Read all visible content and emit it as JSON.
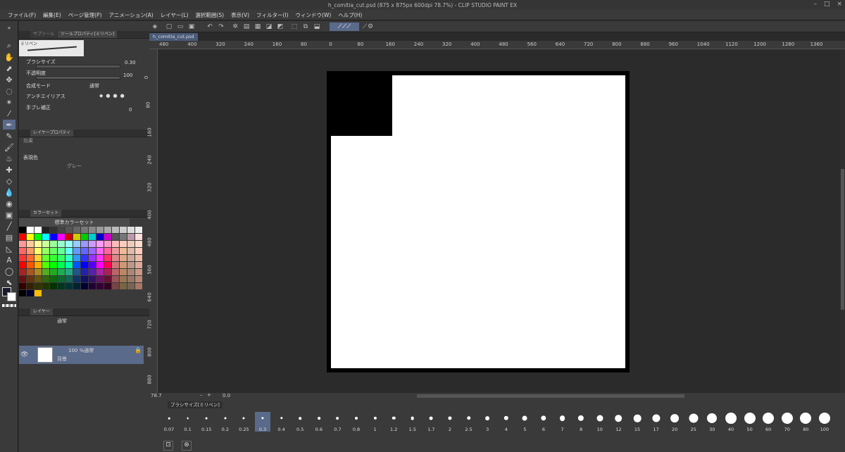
{
  "window": {
    "title": "h_comitia_cut.psd (875 x 875px 600dpi 78.7%) - CLIP STUDIO PAINT EX",
    "controls": [
      "–",
      "□",
      "×"
    ]
  },
  "menu": [
    "ファイル(F)",
    "編集(E)",
    "ページ管理(P)",
    "アニメーション(A)",
    "レイヤー(L)",
    "選択範囲(S)",
    "表示(V)",
    "フィルター(I)",
    "ウィンドウ(W)",
    "ヘルプ(H)"
  ],
  "tool_property": {
    "tabs": [
      "サブツール",
      "ツールプロパティ[ミリペン]"
    ],
    "brush_name": "ミリペン",
    "brush_size_label": "ブラシサイズ",
    "brush_size_value": "0.30",
    "opacity_label": "不透明度",
    "opacity_value": "100",
    "blend_label": "合成モード",
    "blend_value": "通常",
    "antialias_label": "アンチエイリアス",
    "stabilize_label": "手ブレ補正",
    "stabilize_value": "0"
  },
  "layer_property": {
    "tab": "レイヤープロパティ",
    "effect_label": "効果",
    "express_color_label": "表現色",
    "express_color_value": "グレー"
  },
  "color_set": {
    "tab": "カラーセット",
    "name": "標準カラーセット"
  },
  "layer_panel": {
    "tab": "レイヤー",
    "blend": "通常",
    "layer_info": "100 %通常",
    "layer_name": "背景"
  },
  "document": {
    "tab": "h_comitia_cut.psd"
  },
  "rulers": {
    "horizontal": [
      "480",
      "400",
      "320",
      "240",
      "160",
      "80",
      "0",
      "80",
      "160",
      "240",
      "320",
      "400",
      "480",
      "560",
      "640",
      "720",
      "800",
      "880",
      "960",
      "1040",
      "1120",
      "1200",
      "1280",
      "1360"
    ],
    "vertical": [
      "0",
      "80",
      "160",
      "240",
      "320",
      "400",
      "480",
      "560",
      "640",
      "720",
      "800",
      "880"
    ]
  },
  "status": {
    "zoom": "78.7",
    "rotation": "0.0"
  },
  "brush_size_panel": {
    "tab": "ブラシサイズ[ミリペン]",
    "sizes": [
      "0.07",
      "0.1",
      "0.15",
      "0.2",
      "0.25",
      "0.3",
      "0.4",
      "0.5",
      "0.6",
      "0.7",
      "0.8",
      "1",
      "1.2",
      "1.5",
      "1.7",
      "2",
      "2.5",
      "3",
      "4",
      "5",
      "6",
      "7",
      "8",
      "10",
      "12",
      "15",
      "17",
      "20",
      "25",
      "30",
      "40",
      "50",
      "60",
      "70",
      "80",
      "100"
    ],
    "selected": "0.3"
  },
  "colors": {
    "accent": "#5a6a8a",
    "canvas_bg": "#2b2b2b",
    "panel_bg": "#3a3a3a",
    "main_color": "#1a1a2e",
    "sub_color": "#ffffff"
  }
}
